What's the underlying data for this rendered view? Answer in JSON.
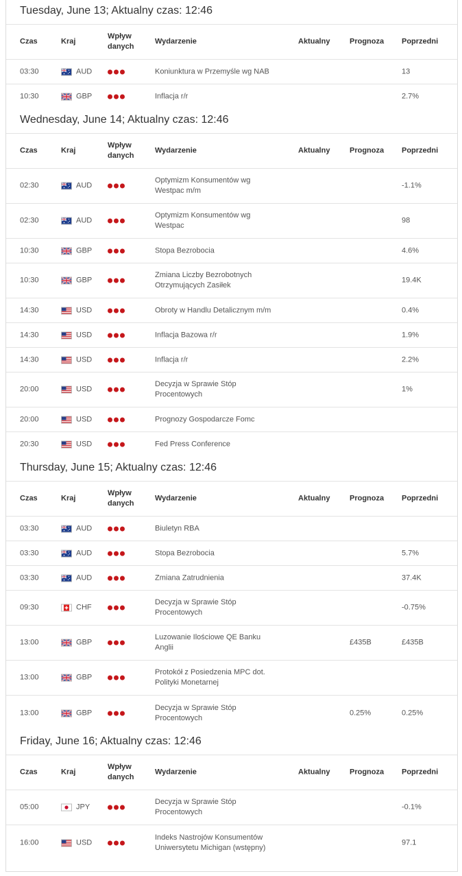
{
  "headers": {
    "time": "Czas",
    "country": "Kraj",
    "impact": "Wpływ danych",
    "event": "Wydarzenie",
    "actual": "Aktualny",
    "forecast": "Prognoza",
    "previous": "Poprzedni"
  },
  "impact_color": "#c5171b",
  "days": [
    {
      "title": "Tuesday, June 13; Aktualny czas: 12:46",
      "rows": [
        {
          "time": "03:30",
          "flag": "au-flag-icon",
          "currency": "AUD",
          "event": "Koniunktura w Przemyśle wg NAB",
          "actual": "",
          "forecast": "",
          "previous": "13"
        },
        {
          "time": "10:30",
          "flag": "gb-flag-icon",
          "currency": "GBP",
          "event": "Inflacja r/r",
          "actual": "",
          "forecast": "",
          "previous": "2.7%"
        }
      ]
    },
    {
      "title": "Wednesday, June 14; Aktualny czas: 12:46",
      "rows": [
        {
          "time": "02:30",
          "flag": "au-flag-icon",
          "currency": "AUD",
          "event": "Optymizm Konsumentów wg Westpac m/m",
          "actual": "",
          "forecast": "",
          "previous": "-1.1%"
        },
        {
          "time": "02:30",
          "flag": "au-flag-icon",
          "currency": "AUD",
          "event": "Optymizm Konsumentów wg Westpac",
          "actual": "",
          "forecast": "",
          "previous": "98"
        },
        {
          "time": "10:30",
          "flag": "gb-flag-icon",
          "currency": "GBP",
          "event": "Stopa Bezrobocia",
          "actual": "",
          "forecast": "",
          "previous": "4.6%"
        },
        {
          "time": "10:30",
          "flag": "gb-flag-icon",
          "currency": "GBP",
          "event": "Zmiana Liczby Bezrobotnych Otrzymujących Zasiłek",
          "actual": "",
          "forecast": "",
          "previous": "19.4K"
        },
        {
          "time": "14:30",
          "flag": "us-flag-icon",
          "currency": "USD",
          "event": "Obroty w Handlu Detalicznym m/m",
          "actual": "",
          "forecast": "",
          "previous": "0.4%"
        },
        {
          "time": "14:30",
          "flag": "us-flag-icon",
          "currency": "USD",
          "event": "Inflacja Bazowa r/r",
          "actual": "",
          "forecast": "",
          "previous": "1.9%"
        },
        {
          "time": "14:30",
          "flag": "us-flag-icon",
          "currency": "USD",
          "event": "Inflacja r/r",
          "actual": "",
          "forecast": "",
          "previous": "2.2%"
        },
        {
          "time": "20:00",
          "flag": "us-flag-icon",
          "currency": "USD",
          "event": "Decyzja w Sprawie Stóp Procentowych",
          "actual": "",
          "forecast": "",
          "previous": "1%"
        },
        {
          "time": "20:00",
          "flag": "us-flag-icon",
          "currency": "USD",
          "event": "Prognozy Gospodarcze Fomc",
          "actual": "",
          "forecast": "",
          "previous": ""
        },
        {
          "time": "20:30",
          "flag": "us-flag-icon",
          "currency": "USD",
          "event": "Fed Press Conference",
          "actual": "",
          "forecast": "",
          "previous": ""
        }
      ]
    },
    {
      "title": "Thursday, June 15; Aktualny czas: 12:46",
      "rows": [
        {
          "time": "03:30",
          "flag": "au-flag-icon",
          "currency": "AUD",
          "event": "Biuletyn RBA",
          "actual": "",
          "forecast": "",
          "previous": ""
        },
        {
          "time": "03:30",
          "flag": "au-flag-icon",
          "currency": "AUD",
          "event": "Stopa Bezrobocia",
          "actual": "",
          "forecast": "",
          "previous": "5.7%"
        },
        {
          "time": "03:30",
          "flag": "au-flag-icon",
          "currency": "AUD",
          "event": "Zmiana Zatrudnienia",
          "actual": "",
          "forecast": "",
          "previous": "37.4K"
        },
        {
          "time": "09:30",
          "flag": "ch-flag-icon",
          "currency": "CHF",
          "event": "Decyzja w Sprawie Stóp Procentowych",
          "actual": "",
          "forecast": "",
          "previous": "-0.75%"
        },
        {
          "time": "13:00",
          "flag": "gb-flag-icon",
          "currency": "GBP",
          "event": "Luzowanie Ilościowe QE Banku Anglii",
          "actual": "",
          "forecast": "£435B",
          "previous": "£435B"
        },
        {
          "time": "13:00",
          "flag": "gb-flag-icon",
          "currency": "GBP",
          "event": "Protokół z Posiedzenia MPC dot. Polityki Monetarnej",
          "actual": "",
          "forecast": "",
          "previous": ""
        },
        {
          "time": "13:00",
          "flag": "gb-flag-icon",
          "currency": "GBP",
          "event": "Decyzja w Sprawie Stóp Procentowych",
          "actual": "",
          "forecast": "0.25%",
          "previous": "0.25%"
        }
      ]
    },
    {
      "title": "Friday, June 16; Aktualny czas: 12:46",
      "rows": [
        {
          "time": "05:00",
          "flag": "jp-flag-icon",
          "currency": "JPY",
          "event": "Decyzja w Sprawie Stóp Procentowych",
          "actual": "",
          "forecast": "",
          "previous": "-0.1%"
        },
        {
          "time": "16:00",
          "flag": "us-flag-icon",
          "currency": "USD",
          "event": "Indeks Nastrojów Konsumentów Uniwersytetu Michigan (wstępny)",
          "actual": "",
          "forecast": "",
          "previous": "97.1"
        }
      ]
    }
  ]
}
